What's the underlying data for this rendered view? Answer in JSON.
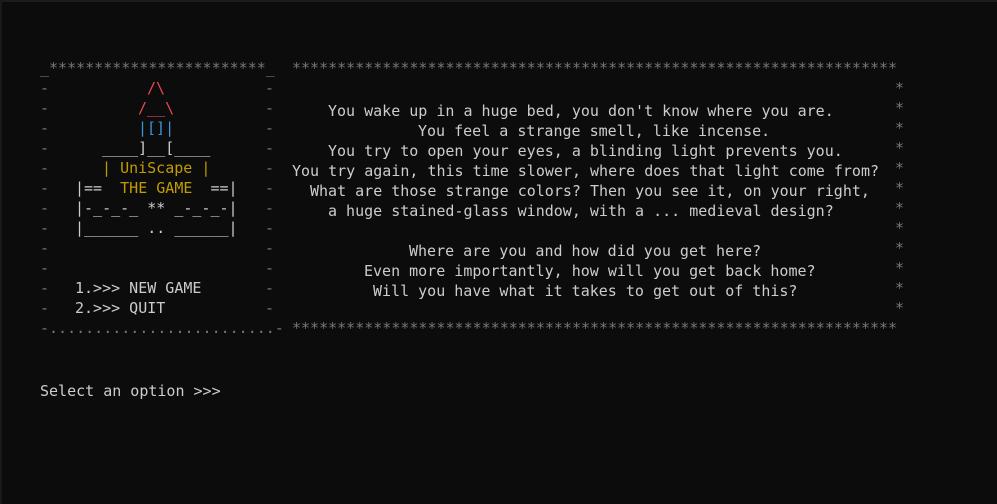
{
  "title_box": {
    "top_border": "_************************_",
    "bottom_border": "-.........................-",
    "side_char": "-",
    "art": {
      "roof_1": "/\\",
      "roof_2": "/__\\",
      "window": "|[]|",
      "base": "____]__[____",
      "name_left": "|",
      "name": "UniScape",
      "name_right": "|",
      "game_left": "|==",
      "game_title": "THE GAME",
      "game_right": "==|",
      "deco_row": "|-_-_-_ ** _-_-_-|",
      "bottom_row": "|______ .. ______|"
    },
    "menu": [
      {
        "label": "1.>>> NEW GAME"
      },
      {
        "label": "2.>>> QUIT"
      }
    ]
  },
  "story_box": {
    "top_border": "*******************************************************************",
    "bottom_border": "*******************************************************************",
    "side_char": "*",
    "paragraph_1": [
      "You wake up in a huge bed, you don't know where you are.",
      "You feel a strange smell, like incense.",
      "You try to open your eyes, a blinding light prevents you.",
      "You try again, this time slower, where does that light come from?",
      "What are those strange colors? Then you see it, on your right,",
      "a huge stained-glass window, with a ... medieval design?"
    ],
    "paragraph_2": [
      "Where are you and how did you get here?",
      "Even more importantly, how will you get back home?",
      "Will you have what it takes to get out of this?"
    ]
  },
  "prompt": {
    "text": "Select an option >>>"
  },
  "colors": {
    "background": "#0c0c0c",
    "text": "#cccccc",
    "border": "#767676",
    "roof": "#e74856",
    "window": "#3a96dd",
    "title": "#c19c00"
  }
}
